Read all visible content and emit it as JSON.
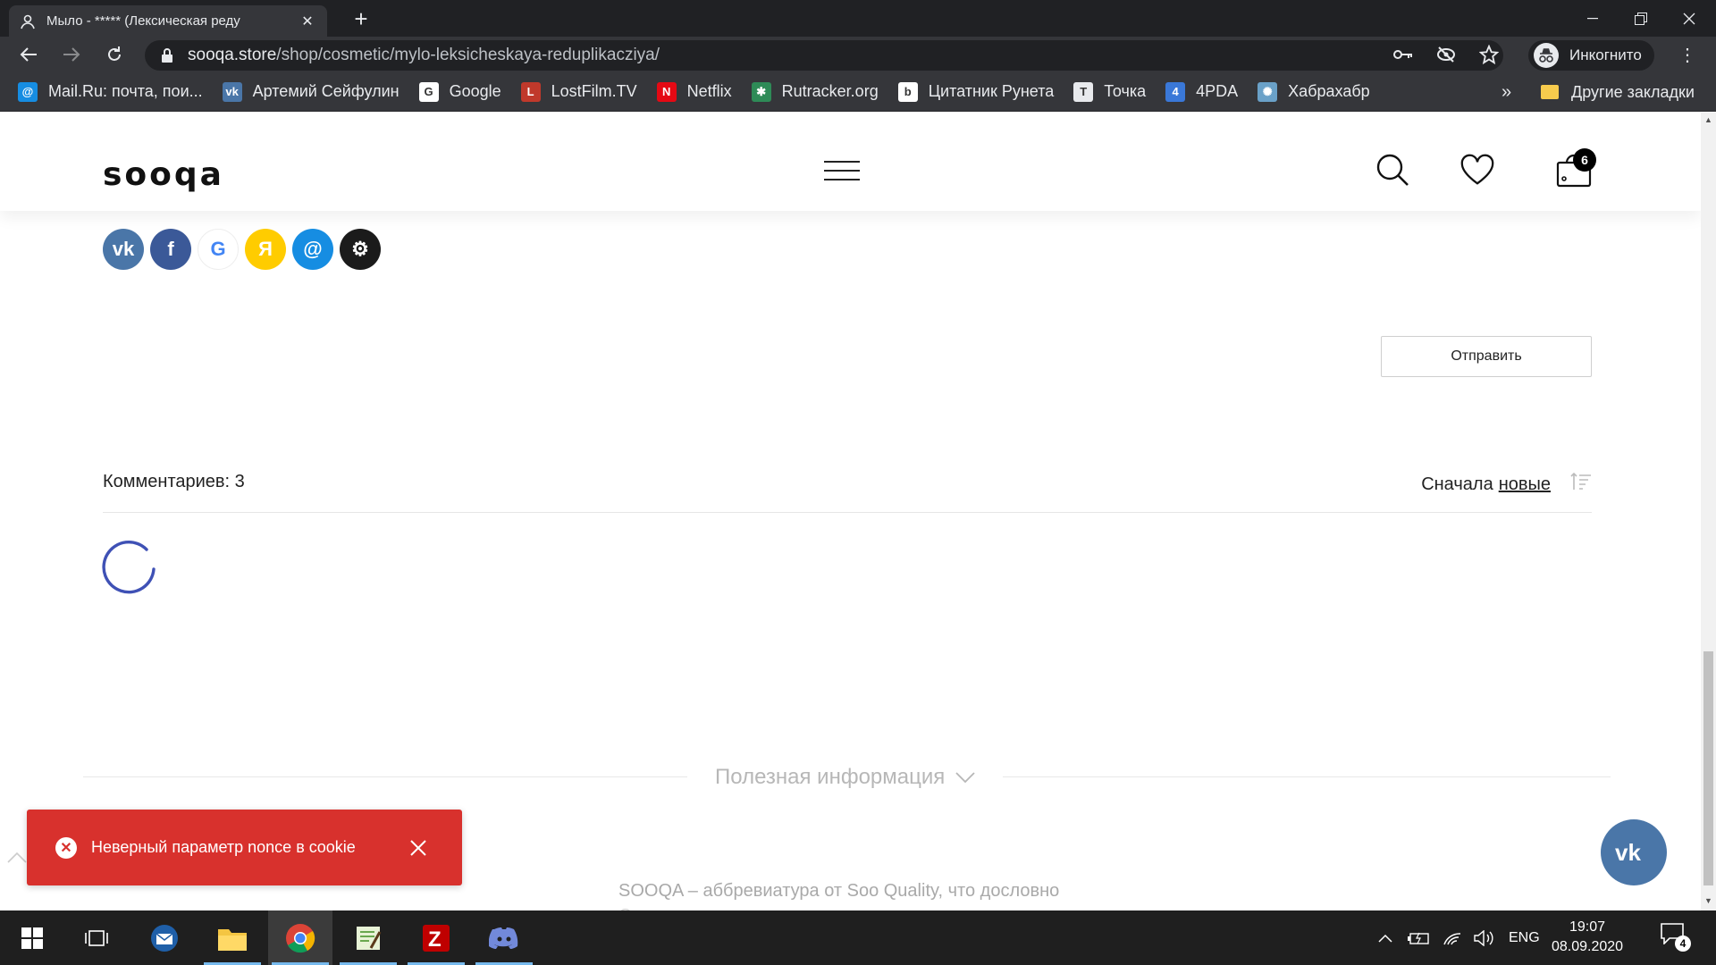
{
  "browser": {
    "tab_title": "Мыло - ***** (Лексическая реду",
    "url_host": "sooqa.store",
    "url_path": "/shop/cosmetic/mylo-leksicheskaya-reduplikacziya/",
    "profile_label": "Инкогнито",
    "bookmarks": [
      {
        "label": "Mail.Ru: почта, пои...",
        "icon": "mailru-icon",
        "color": "#168de2",
        "glyph": "@"
      },
      {
        "label": "Артемий Сейфулин",
        "icon": "vk-icon",
        "color": "#4a76a8",
        "glyph": "vk"
      },
      {
        "label": "Google",
        "icon": "google-icon",
        "color": "#ffffff",
        "glyph": "G"
      },
      {
        "label": "LostFilm.TV",
        "icon": "lostfilm-icon",
        "color": "#c0392b",
        "glyph": "L"
      },
      {
        "label": "Netflix",
        "icon": "netflix-icon",
        "color": "#e50914",
        "glyph": "N"
      },
      {
        "label": "Rutracker.org",
        "icon": "rutracker-icon",
        "color": "#2e8b57",
        "glyph": "✱"
      },
      {
        "label": "Цитатник Рунета",
        "icon": "bash-icon",
        "color": "#ffffff",
        "glyph": "b"
      },
      {
        "label": "Точка",
        "icon": "tochka-icon",
        "color": "#e8eaed",
        "glyph": "T"
      },
      {
        "label": "4PDA",
        "icon": "4pda-icon",
        "color": "#3a78d8",
        "glyph": "4"
      },
      {
        "label": "Хабрахабр",
        "icon": "habr-icon",
        "color": "#6aa1c8",
        "glyph": "✺"
      }
    ],
    "bookmarks_more": "»",
    "other_bookmarks": "Другие закладки"
  },
  "site": {
    "logo": "sooqa",
    "cart_count": "6",
    "social_logins": [
      {
        "name": "vk",
        "color": "#4a76a8",
        "glyph": "vk"
      },
      {
        "name": "facebook",
        "color": "#3b5998",
        "glyph": "f"
      },
      {
        "name": "google",
        "color": "#ffffff",
        "glyph": "G"
      },
      {
        "name": "yandex",
        "color": "#ffcc00",
        "glyph": "Я"
      },
      {
        "name": "mailru",
        "color": "#168de2",
        "glyph": "@"
      },
      {
        "name": "steam",
        "color": "#1b1b1b",
        "glyph": "⚙"
      }
    ],
    "submit_label": "Отправить",
    "comments_count": "Комментариев: 3",
    "sort_prefix": "Сначала",
    "sort_value": "новые",
    "info_title": "Полезная информация",
    "footer_line1": "SOOQA – аббревиатура от Soo Quality, что дословно",
    "footer_line2": "Очень качественно"
  },
  "toast": {
    "message": "Неверный параметр nonce в cookie",
    "color": "#d8312d"
  },
  "taskbar": {
    "apps": [
      "windows-start",
      "task-view",
      "thunderbird",
      "file-explorer",
      "chrome",
      "notepad-plus",
      "filezilla",
      "discord"
    ],
    "language": "ENG",
    "time": "19:07",
    "date": "08.09.2020",
    "notifications": "4"
  }
}
